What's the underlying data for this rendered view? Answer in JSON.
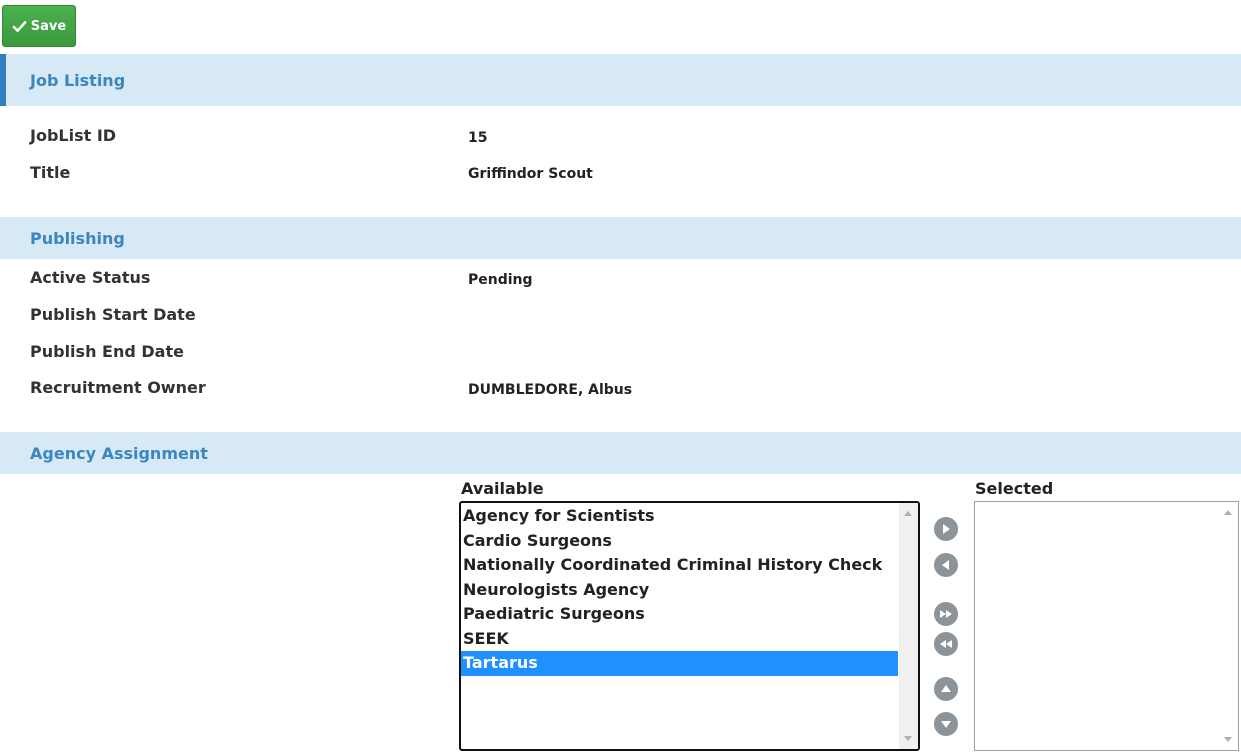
{
  "toolbar": {
    "save_label": "Save"
  },
  "job_listing": {
    "header": "Job Listing",
    "fields": [
      {
        "label": "JobList ID",
        "value": "15"
      },
      {
        "label": "Title",
        "value": "Griffindor Scout"
      }
    ]
  },
  "publishing": {
    "header": "Publishing",
    "fields": [
      {
        "label": "Active Status",
        "value": "Pending"
      },
      {
        "label": "Publish Start Date",
        "value": ""
      },
      {
        "label": "Publish End Date",
        "value": ""
      },
      {
        "label": "Recruitment Owner",
        "value": "DUMBLEDORE, Albus"
      }
    ]
  },
  "agency_assignment": {
    "header": "Agency Assignment",
    "available_label": "Available",
    "selected_label": "Selected",
    "available_items": [
      "Agency for Scientists",
      "Cardio Surgeons",
      "Nationally Coordinated Criminal History Check",
      "Neurologists Agency",
      "Paediatric Surgeons",
      "SEEK",
      "Tartarus"
    ],
    "highlighted_item": "Tartarus",
    "selected_items": []
  },
  "colors": {
    "accent": "#3b86c1",
    "header_bg": "#d6e9f5",
    "save_green": "#43a047",
    "highlight": "#1e90ff"
  }
}
